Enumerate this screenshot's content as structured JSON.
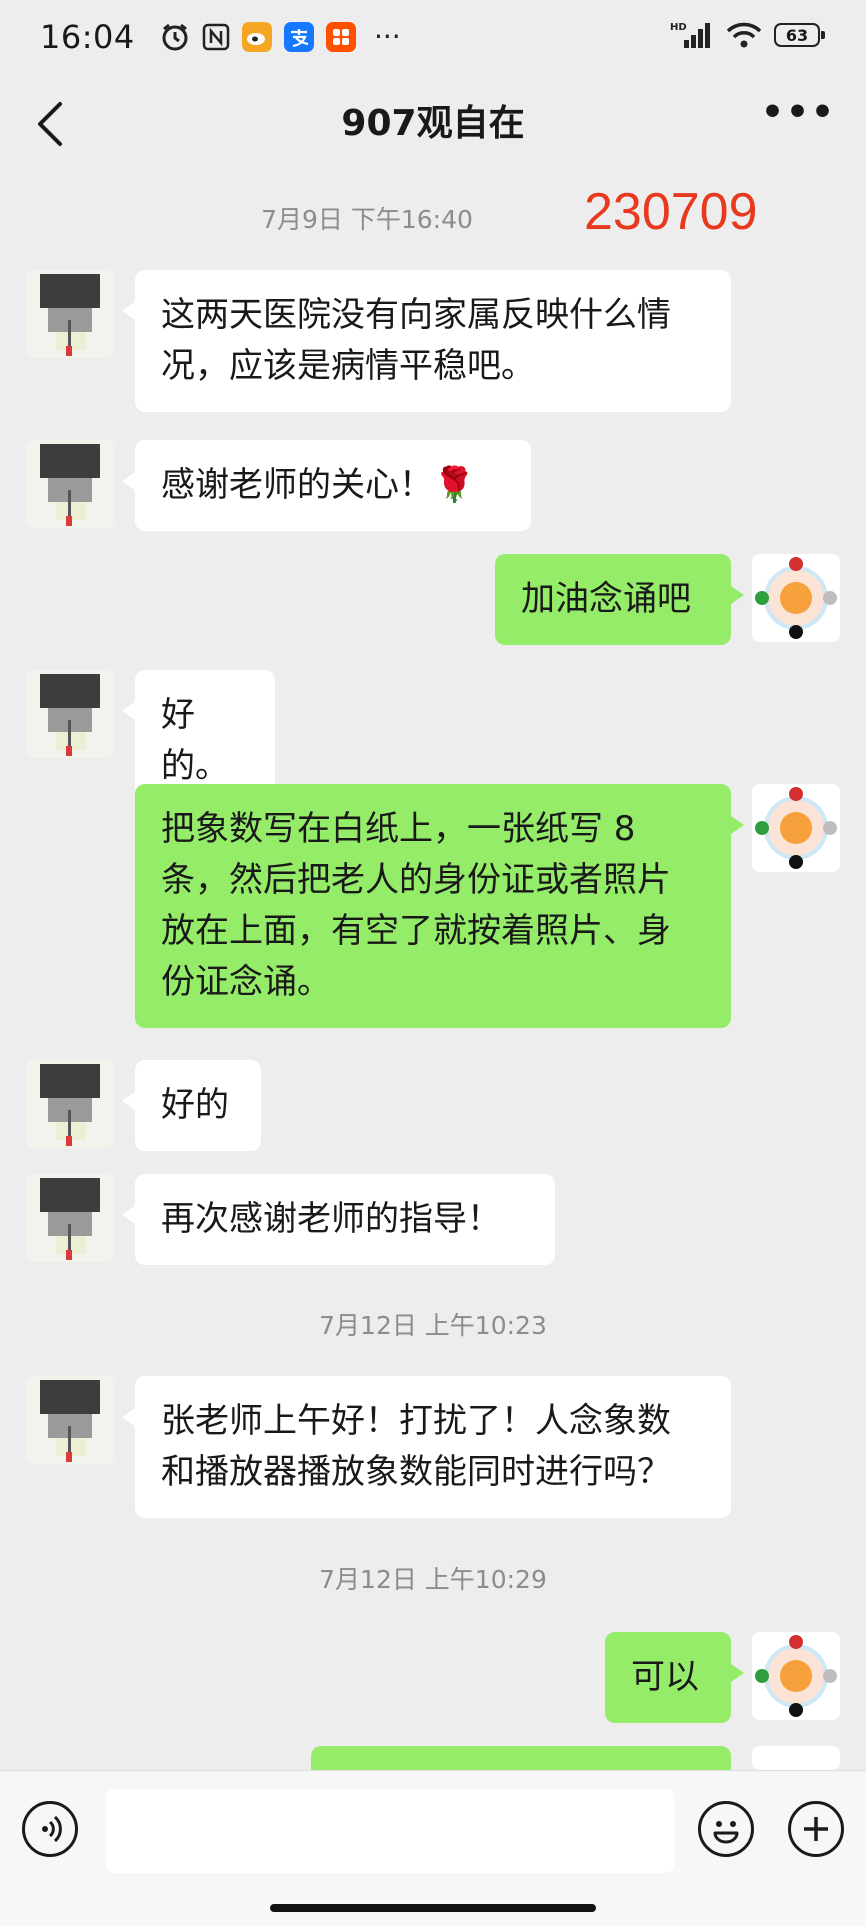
{
  "status_bar": {
    "time": "16:04",
    "icons": [
      "alarm-icon",
      "nfc-icon",
      "weibo-icon",
      "alipay-icon",
      "taobao-icon",
      "more-dots-icon"
    ],
    "signal": "HD",
    "battery": "63"
  },
  "header": {
    "title": "907观自在"
  },
  "stamp": "230709",
  "messages": [
    {
      "type": "time",
      "text": "7月9日 下午16:40"
    },
    {
      "type": "left",
      "text": "这两天医院没有向家属反映什么情况，应该是病情平稳吧。",
      "lines": [
        "这两天医院没有向家属反映什么情",
        "况，应该是病情平稳吧。"
      ]
    },
    {
      "type": "left",
      "text": "感谢老师的关心！🌹"
    },
    {
      "type": "right",
      "text": "加油念诵吧"
    },
    {
      "type": "left",
      "text": "好的。"
    },
    {
      "type": "right",
      "lines": [
        "把象数写在白纸上，一张纸写 8",
        "条，然后把老人的身份证或者照片",
        "放在上面，有空了就按着照片、身",
        "份证念诵。"
      ]
    },
    {
      "type": "left",
      "text": "好的"
    },
    {
      "type": "left",
      "text": "再次感谢老师的指导！"
    },
    {
      "type": "time",
      "text": "7月12日 上午10:23"
    },
    {
      "type": "left",
      "lines": [
        "张老师上午好！打扰了！人念象数",
        "和播放器播放象数能同时进行吗？"
      ]
    },
    {
      "type": "time",
      "text": "7月12日 上午10:29"
    },
    {
      "type": "right",
      "text": "可以"
    }
  ],
  "colors": {
    "background": "#ededed",
    "bubble_self": "#95ec69",
    "bubble_other": "#ffffff",
    "stamp": "#e8391f"
  }
}
